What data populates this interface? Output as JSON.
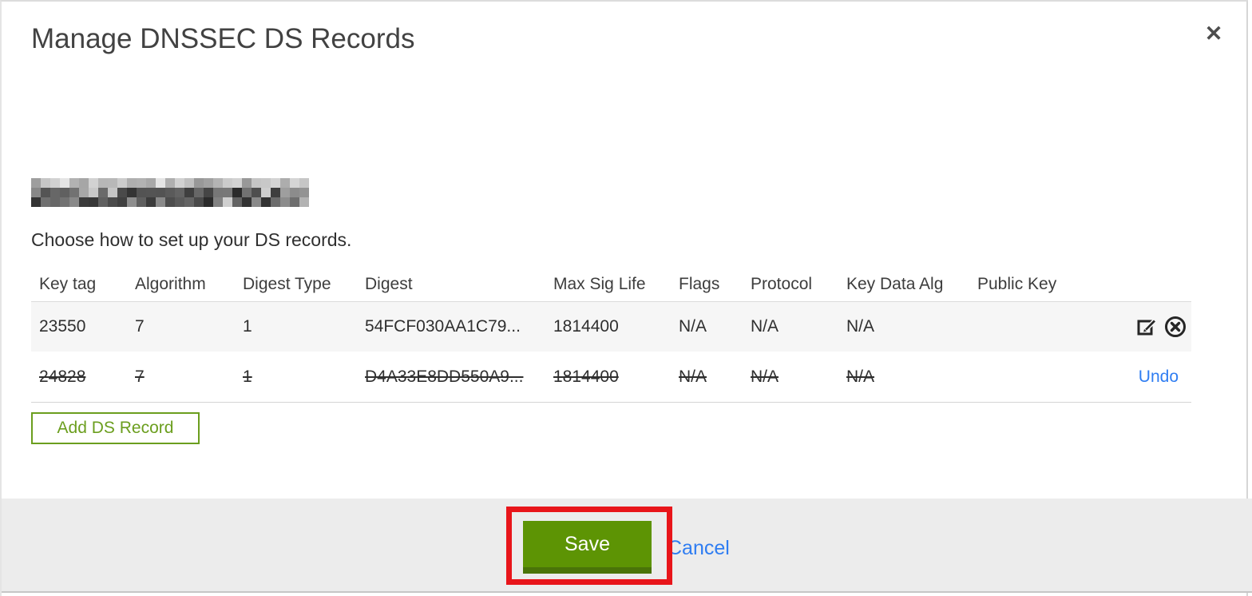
{
  "modal": {
    "title": "Manage DNSSEC DS Records",
    "close_icon": "✕",
    "instruction": "Choose how to set up your DS records.",
    "domain_redacted": true
  },
  "table": {
    "columns": {
      "key_tag": "Key tag",
      "algorithm": "Algorithm",
      "digest_type": "Digest Type",
      "digest": "Digest",
      "max_sig_life": "Max Sig Life",
      "flags": "Flags",
      "protocol": "Protocol",
      "key_data_alg": "Key Data Alg",
      "public_key": "Public Key"
    },
    "rows": [
      {
        "key_tag": "23550",
        "algorithm": "7",
        "digest_type": "1",
        "digest": "54FCF030AA1C79...",
        "max_sig_life": "1814400",
        "flags": "N/A",
        "protocol": "N/A",
        "key_data_alg": "N/A",
        "public_key": "",
        "state": "active"
      },
      {
        "key_tag": "24828",
        "algorithm": "7",
        "digest_type": "1",
        "digest": "D4A33E8DD550A9...",
        "max_sig_life": "1814400",
        "flags": "N/A",
        "protocol": "N/A",
        "key_data_alg": "N/A",
        "public_key": "",
        "state": "deleted",
        "undo_label": "Undo"
      }
    ]
  },
  "buttons": {
    "add_ds_record": "Add DS Record",
    "save": "Save",
    "cancel": "Cancel"
  },
  "colors": {
    "green_button": "#5d9404",
    "green_outline": "#6b9e1e",
    "link_blue": "#2f7df2",
    "annotation_red": "#e8151a",
    "footer_gray": "#ececec",
    "row_gray": "#f6f6f6"
  }
}
